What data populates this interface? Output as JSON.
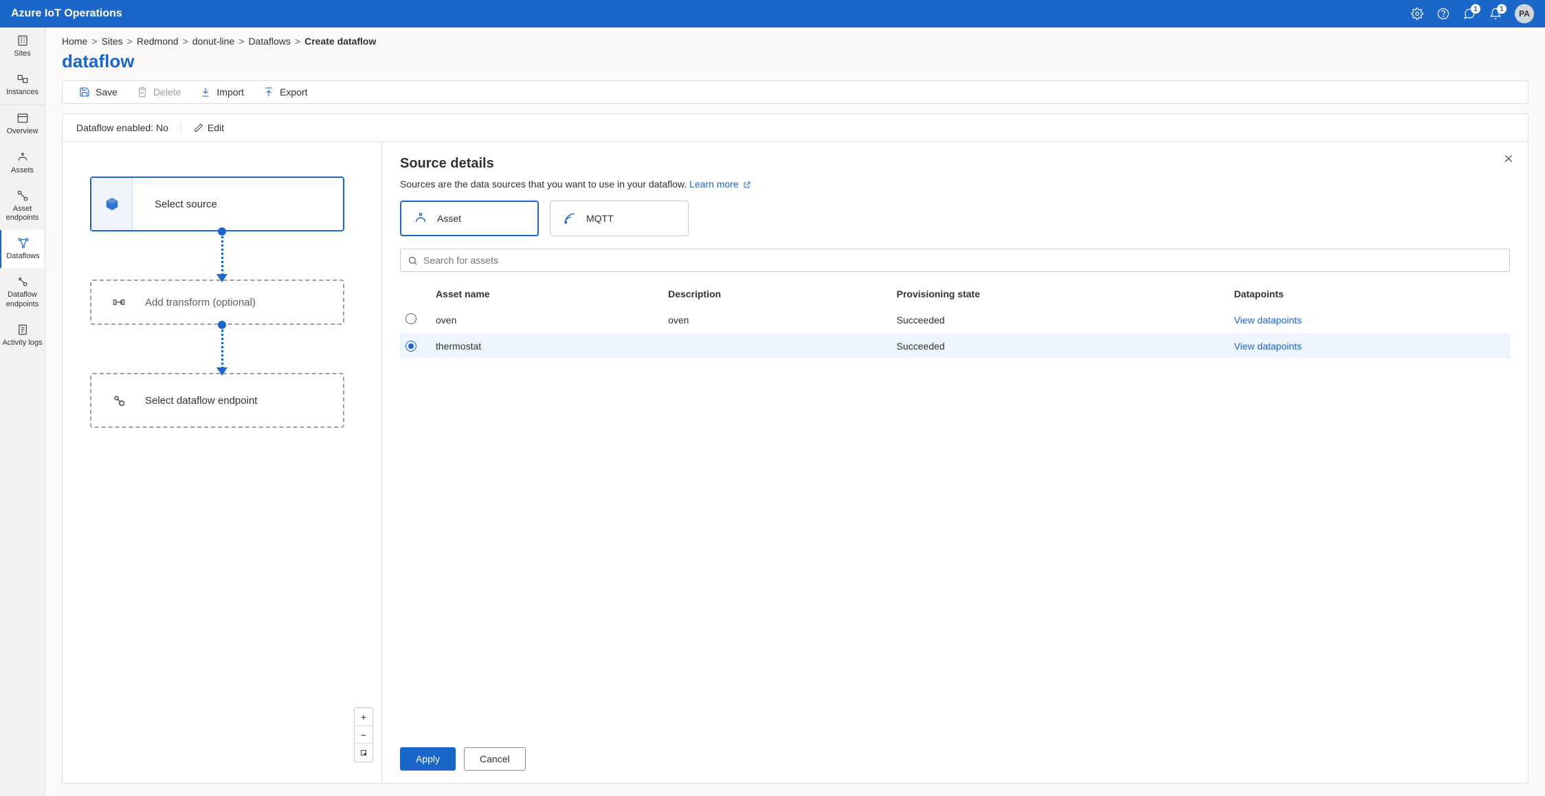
{
  "header": {
    "product_name": "Azure IoT Operations",
    "badge1": "1",
    "badge2": "1",
    "avatar": "PA"
  },
  "sidenav": {
    "items": [
      {
        "label": "Sites"
      },
      {
        "label": "Instances"
      },
      {
        "label": "Overview"
      },
      {
        "label": "Assets"
      },
      {
        "label": "Asset endpoints"
      },
      {
        "label": "Dataflows"
      },
      {
        "label": "Dataflow endpoints"
      },
      {
        "label": "Activity logs"
      }
    ]
  },
  "breadcrumb": {
    "items": [
      "Home",
      "Sites",
      "Redmond",
      "donut-line",
      "Dataflows"
    ],
    "current": "Create dataflow"
  },
  "page": {
    "title": "dataflow"
  },
  "commands": {
    "save": "Save",
    "delete": "Delete",
    "import": "Import",
    "export": "Export"
  },
  "status": {
    "enabled_label": "Dataflow enabled: No",
    "edit": "Edit"
  },
  "canvas": {
    "source_label": "Select source",
    "transform_label": "Add transform (optional)",
    "endpoint_label": "Select dataflow endpoint"
  },
  "details": {
    "title": "Source details",
    "subtitle": "Sources are the data sources that you want to use in your dataflow.",
    "learn_more": "Learn more",
    "tabs": {
      "asset": "Asset",
      "mqtt": "MQTT"
    },
    "search_placeholder": "Search for assets",
    "columns": {
      "name": "Asset name",
      "description": "Description",
      "state": "Provisioning state",
      "datapoints": "Datapoints"
    },
    "assets": [
      {
        "name": "oven",
        "description": "oven",
        "state": "Succeeded",
        "view": "View datapoints",
        "selected": false
      },
      {
        "name": "thermostat",
        "description": "",
        "state": "Succeeded",
        "view": "View datapoints",
        "selected": true
      }
    ],
    "buttons": {
      "apply": "Apply",
      "cancel": "Cancel"
    }
  }
}
